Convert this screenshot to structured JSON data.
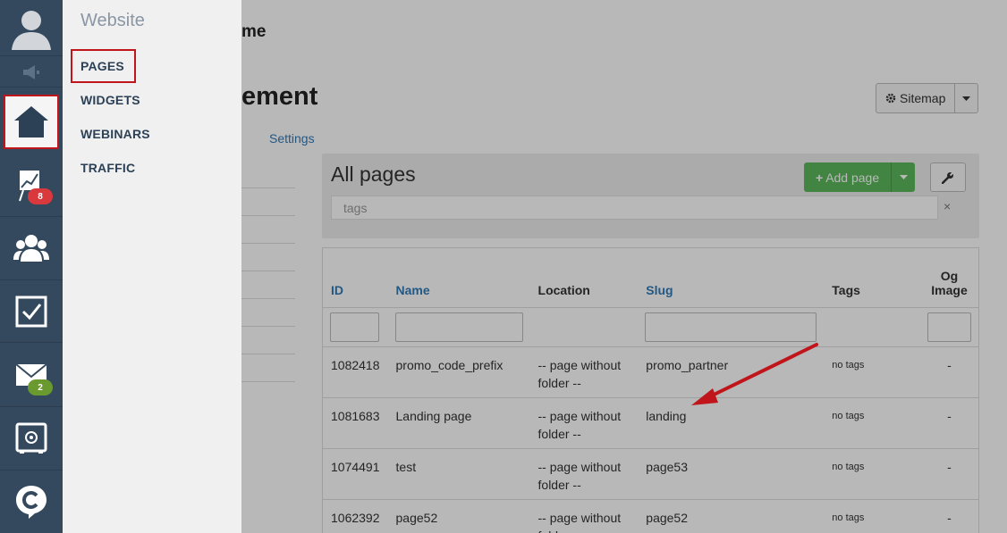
{
  "sidebar_rail": {
    "items": [
      {
        "icon": "user-avatar-icon"
      },
      {
        "icon": "megaphone-icon"
      },
      {
        "icon": "home-icon",
        "active": true
      },
      {
        "icon": "chart-board-icon",
        "badge": "8"
      },
      {
        "icon": "users-group-icon"
      },
      {
        "icon": "checkbox-icon"
      },
      {
        "icon": "envelope-icon",
        "badge": "2"
      },
      {
        "icon": "safe-icon"
      },
      {
        "icon": "brand-c-icon"
      }
    ]
  },
  "flyout": {
    "title": "Website",
    "items": [
      "PAGES",
      "WIDGETS",
      "WEBINARS",
      "TRAFFIC"
    ],
    "active": "PAGES"
  },
  "header": {
    "partial_title": "me",
    "page_title_partial": "ement",
    "settings_link": "Settings",
    "sitemap_label": "Sitemap"
  },
  "pages_panel": {
    "title": "All pages",
    "add_label": "Add page",
    "tags_placeholder": "tags",
    "clear_symbol": "×"
  },
  "table": {
    "columns": [
      "ID",
      "Name",
      "Location",
      "Slug",
      "Tags",
      "Og Image"
    ],
    "rows": [
      {
        "id": "1082418",
        "name": "promo_code_prefix",
        "location": "-- page without folder --",
        "slug": "promo_partner",
        "tags": "no tags",
        "og_image": "-"
      },
      {
        "id": "1081683",
        "name": "Landing page",
        "location": "-- page without folder --",
        "slug": "landing",
        "tags": "no tags",
        "og_image": "-"
      },
      {
        "id": "1074491",
        "name": "test",
        "location": "-- page without folder --",
        "slug": "page53",
        "tags": "no tags",
        "og_image": "-"
      },
      {
        "id": "1062392",
        "name": "page52",
        "location": "-- page without folder --",
        "slug": "page52",
        "tags": "no tags",
        "og_image": "-"
      }
    ]
  },
  "colors": {
    "rail": "#34495e",
    "link": "#337ab7",
    "highlight": "#c0161b",
    "success": "#5cb85c"
  }
}
